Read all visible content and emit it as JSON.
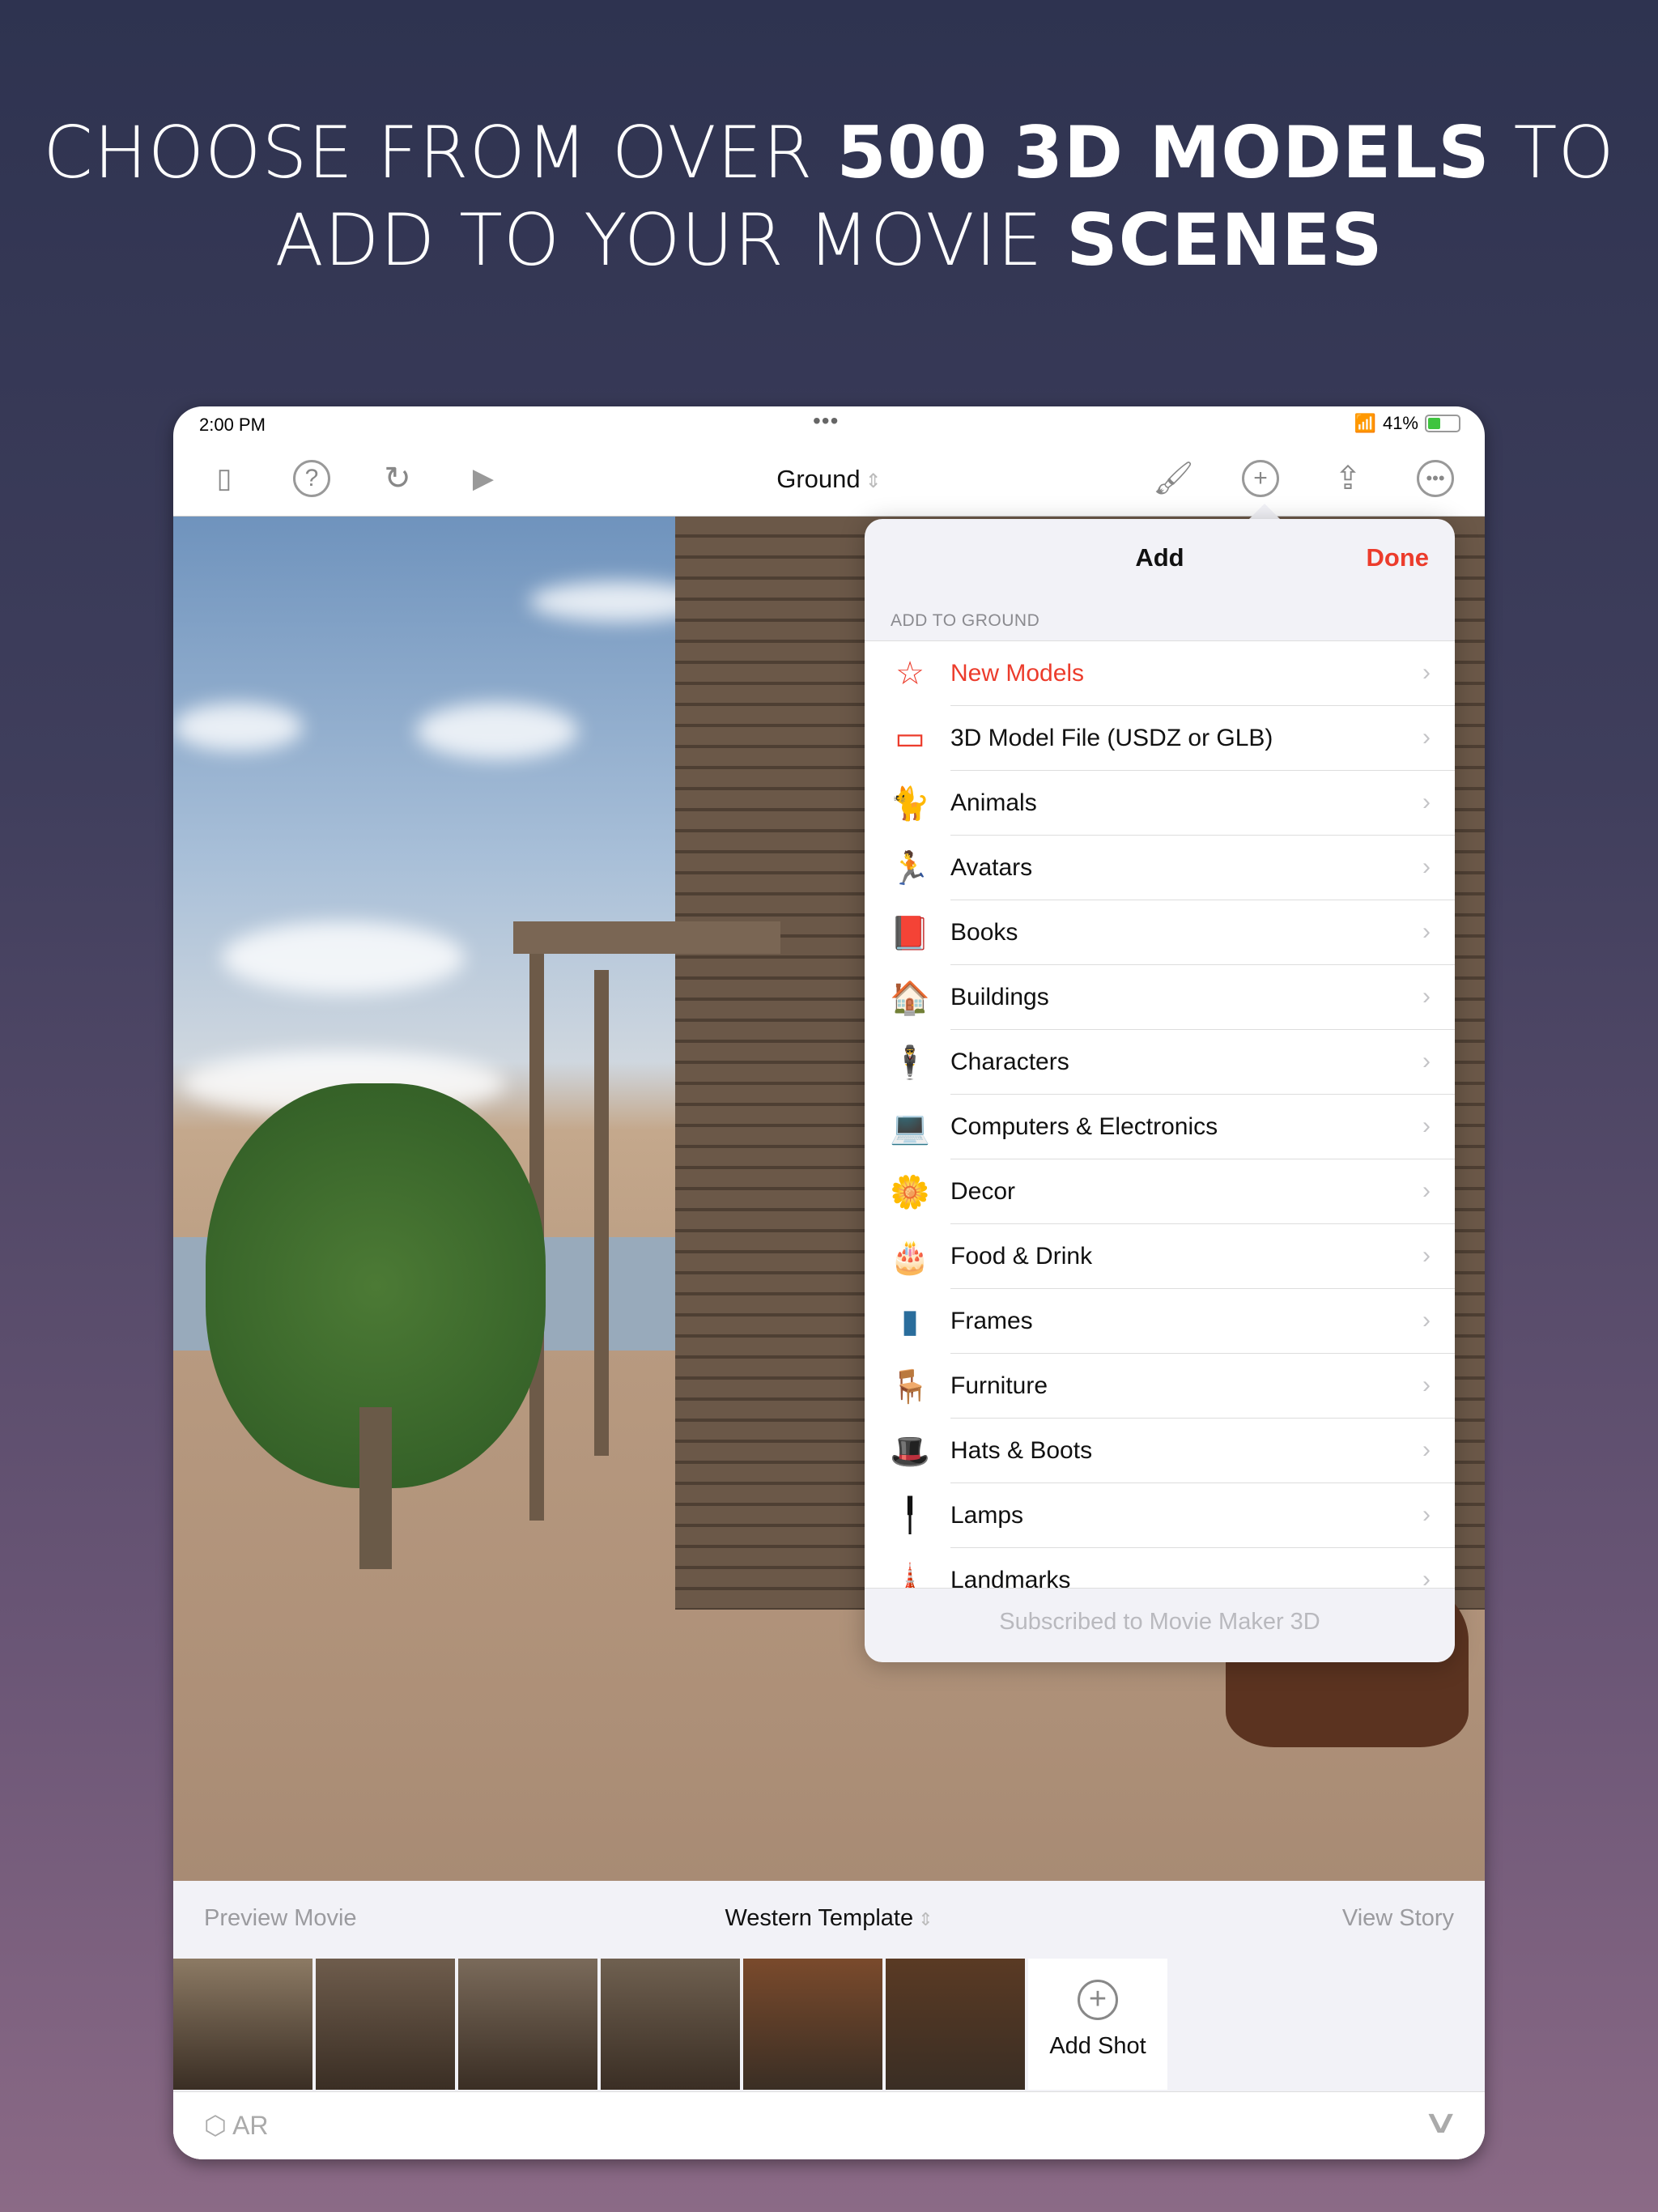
{
  "headline": {
    "line1_pre": "CHOOSE FROM OVER ",
    "line1_bold": "500 3D MODELS",
    "line1_post": " TO",
    "line2_pre": "ADD TO YOUR MOVIE ",
    "line2_bold": "SCENES"
  },
  "status": {
    "time": "2:00 PM",
    "dots": "•••",
    "battery": "41%",
    "battery_level": 0.41
  },
  "toolbar": {
    "title": "Ground",
    "icons": [
      "sidebar-icon",
      "help-icon",
      "redo-icon",
      "play-icon",
      "paintbrush-icon",
      "add-icon",
      "share-icon",
      "more-icon"
    ]
  },
  "popover": {
    "title": "Add",
    "done": "Done",
    "section": "ADD TO GROUND",
    "footer": "Subscribed to Movie Maker 3D",
    "items": [
      {
        "label": "New Models",
        "icon": "☆",
        "color": "#ec3c2c"
      },
      {
        "label": "3D Model File (USDZ or GLB)",
        "icon": "▭",
        "color": "#ec3c2c"
      },
      {
        "label": "Animals",
        "icon": "🐈",
        "color": "#111"
      },
      {
        "label": "Avatars",
        "icon": "🏃",
        "color": "#ec3c2c"
      },
      {
        "label": "Books",
        "icon": "📕",
        "color": "#8b1a1a"
      },
      {
        "label": "Buildings",
        "icon": "🏠",
        "color": "#c33"
      },
      {
        "label": "Characters",
        "icon": "🕴",
        "color": "#111"
      },
      {
        "label": "Computers & Electronics",
        "icon": "💻",
        "color": "#444"
      },
      {
        "label": "Decor",
        "icon": "🌼",
        "color": "#d9b300"
      },
      {
        "label": "Food & Drink",
        "icon": "🎂",
        "color": "#d44"
      },
      {
        "label": "Frames",
        "icon": "▮",
        "color": "#2a6d9c"
      },
      {
        "label": "Furniture",
        "icon": "🪑",
        "color": "#4a6ad8"
      },
      {
        "label": "Hats & Boots",
        "icon": "🎩",
        "color": "#111"
      },
      {
        "label": "Lamps",
        "icon": "╿",
        "color": "#111"
      },
      {
        "label": "Landmarks",
        "icon": "🗼",
        "color": "#a55"
      }
    ]
  },
  "bottom": {
    "preview": "Preview Movie",
    "template": "Western Template",
    "view_story": "View Story",
    "add_shot": "Add Shot",
    "ar": "AR",
    "thumb_colors": [
      "#8c7a64",
      "#6e5c4c",
      "#7a6a5a",
      "#6f6050",
      "#7a4a2c",
      "#5a3a24"
    ]
  }
}
